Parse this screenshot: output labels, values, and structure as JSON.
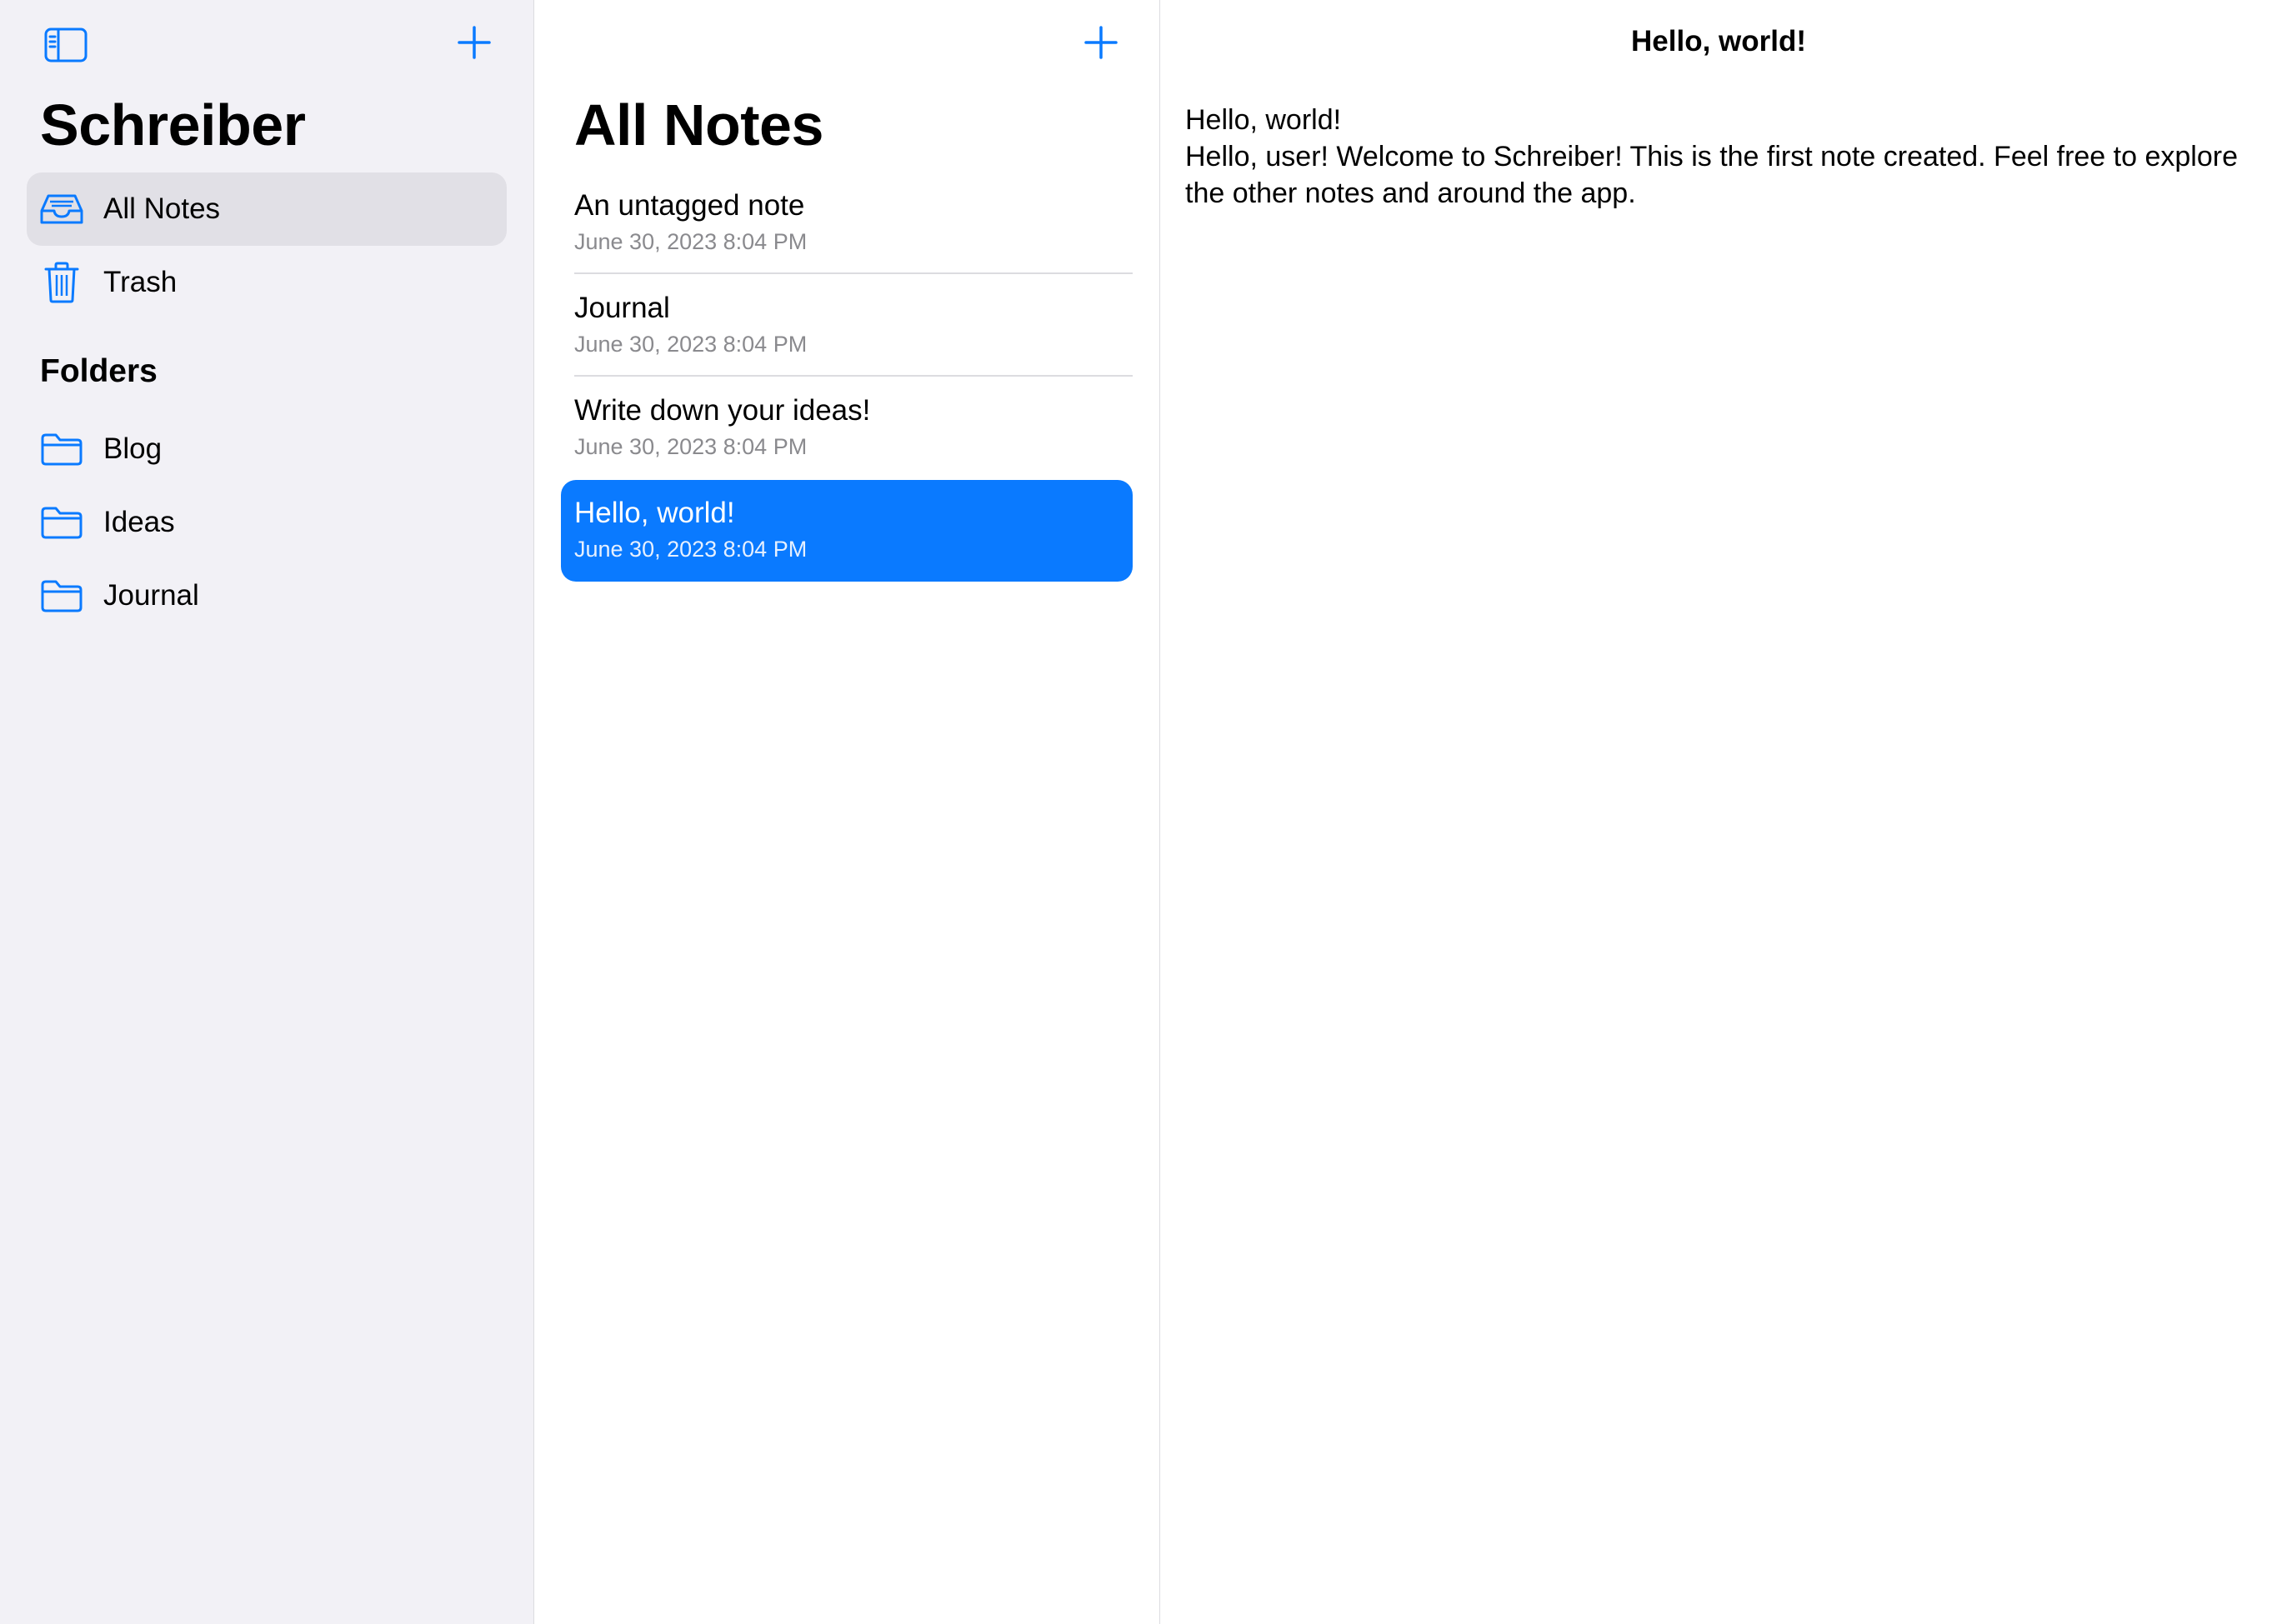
{
  "colors": {
    "accent": "#0a7aff",
    "sidebar_bg": "#f2f1f6",
    "selected_nav_bg": "#e1e0e6",
    "secondary_text": "#8a8a8e"
  },
  "sidebar": {
    "toggle_icon": "sidebar-left-icon",
    "add_icon": "plus-icon",
    "title": "Schreiber",
    "items": [
      {
        "label": "All Notes",
        "icon": "tray-icon",
        "selected": true
      },
      {
        "label": "Trash",
        "icon": "trash-icon",
        "selected": false
      }
    ],
    "folders_header": "Folders",
    "folders": [
      {
        "label": "Blog",
        "icon": "folder-icon"
      },
      {
        "label": "Ideas",
        "icon": "folder-icon"
      },
      {
        "label": "Journal",
        "icon": "folder-icon"
      }
    ]
  },
  "notelist": {
    "add_icon": "plus-icon",
    "title": "All Notes",
    "notes": [
      {
        "title": "An untagged note",
        "date": "June 30, 2023 8:04 PM",
        "selected": false
      },
      {
        "title": "Journal",
        "date": "June 30, 2023 8:04 PM",
        "selected": false
      },
      {
        "title": "Write down your ideas!",
        "date": "June 30, 2023 8:04 PM",
        "selected": false
      },
      {
        "title": "Hello, world!",
        "date": "June 30, 2023 8:04 PM",
        "selected": true
      }
    ]
  },
  "detail": {
    "nav_title": "Hello, world!",
    "body_line1": "Hello, world!",
    "body_line2": "Hello, user! Welcome to Schreiber! This is the first note created. Feel free to explore the other notes and around the app."
  }
}
